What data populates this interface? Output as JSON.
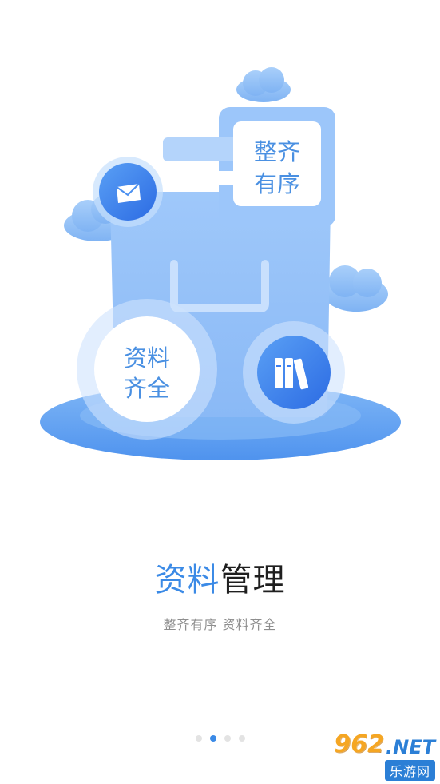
{
  "illustration": {
    "bubble_top_line1": "整齐",
    "bubble_top_line2": "有序",
    "bubble_left_line1": "资料",
    "bubble_left_line2": "齐全"
  },
  "headline": {
    "highlight": "资料",
    "rest": "管理"
  },
  "subtitle": "整齐有序  资料齐全",
  "pager": {
    "count": 4,
    "active_index": 1
  },
  "watermark": {
    "number": "962",
    "domain": ".NET",
    "site": "乐游网"
  },
  "colors": {
    "accent": "#3b8ae6",
    "illustration_blue": "#8dbcf8",
    "dot_inactive": "#e3e3e3"
  }
}
